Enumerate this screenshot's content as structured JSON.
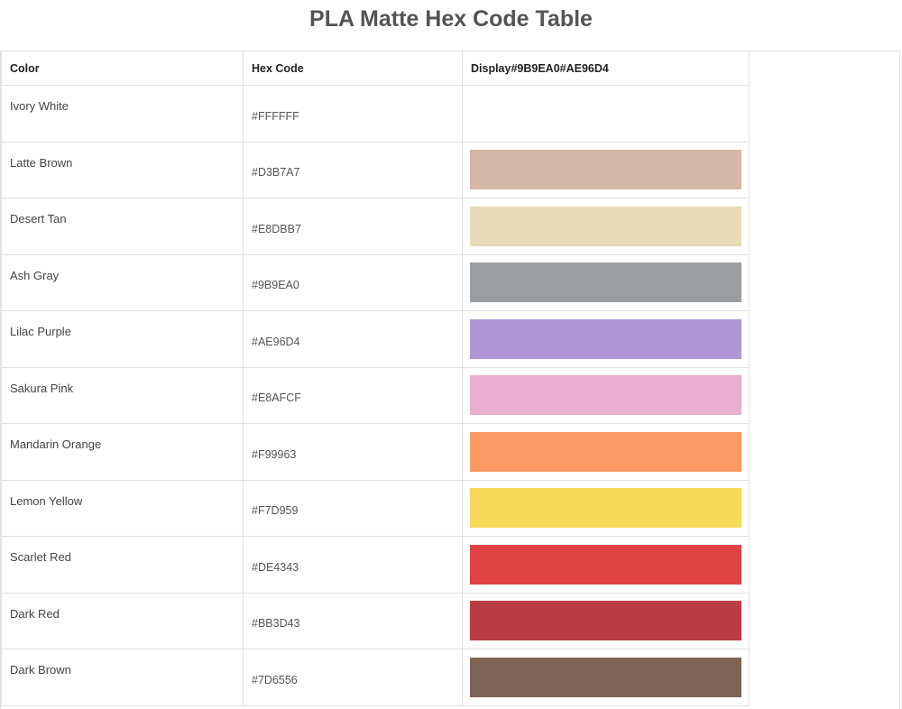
{
  "page": {
    "title": "PLA Matte Hex Code Table"
  },
  "table": {
    "headers": {
      "color": "Color",
      "hex_code": "Hex Code",
      "display": "Display#9B9EA0#AE96D4"
    },
    "rows": [
      {
        "name": "Ivory White",
        "hex": "#FFFFFF",
        "swatch": "#FFFFFF"
      },
      {
        "name": "Latte Brown",
        "hex": "#D3B7A7",
        "swatch": "#D3B7A7"
      },
      {
        "name": "Desert Tan",
        "hex": "#E8DBB7",
        "swatch": "#E8DBB7"
      },
      {
        "name": "Ash Gray",
        "hex": "#9B9EA0",
        "swatch": "#9B9EA0"
      },
      {
        "name": "Lilac Purple",
        "hex": "#AE96D4",
        "swatch": "#AE96D4"
      },
      {
        "name": "Sakura Pink",
        "hex": "#E8AFCF",
        "swatch": "#E8AFCF"
      },
      {
        "name": "Mandarin Orange",
        "hex": "#F99963",
        "swatch": "#F99963"
      },
      {
        "name": "Lemon Yellow",
        "hex": "#F7D959",
        "swatch": "#F7D959"
      },
      {
        "name": "Scarlet Red",
        "hex": "#DE4343",
        "swatch": "#DE4343"
      },
      {
        "name": "Dark Red",
        "hex": "#BB3D43",
        "swatch": "#BB3D43"
      },
      {
        "name": "Dark Brown",
        "hex": "#7D6556",
        "swatch": "#7D6556"
      }
    ]
  }
}
